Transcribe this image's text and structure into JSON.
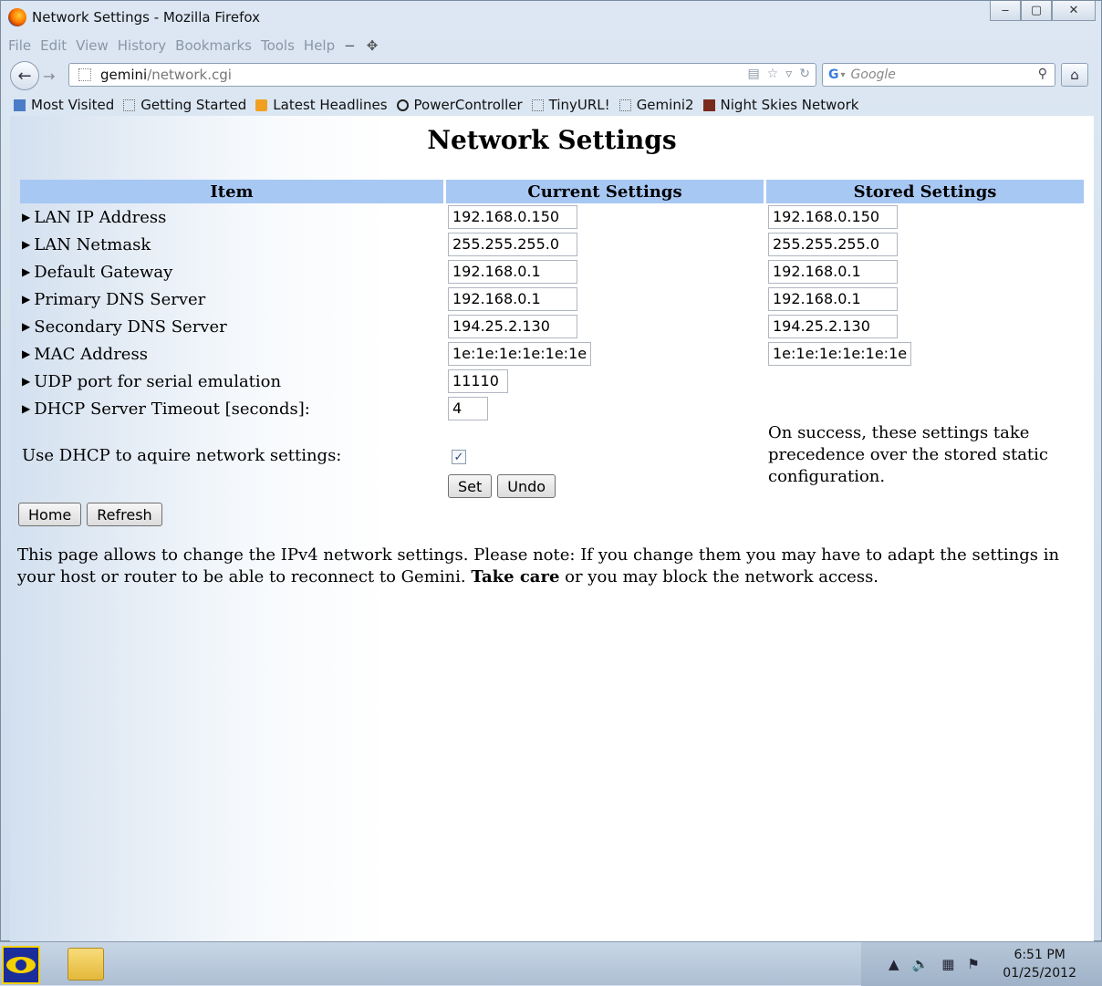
{
  "window": {
    "title": "Network Settings - Mozilla Firefox",
    "controls": {
      "minimize": "▭",
      "maximize": "▢",
      "close": "✕"
    }
  },
  "menu": [
    "File",
    "Edit",
    "View",
    "History",
    "Bookmarks",
    "Tools",
    "Help"
  ],
  "nav": {
    "url_host": "gemini",
    "url_path": "/network.cgi",
    "search_placeholder": "Google"
  },
  "bookmarks": [
    {
      "label": "Most Visited",
      "icon": "most-visited-icon"
    },
    {
      "label": "Getting Started",
      "icon": "page-icon"
    },
    {
      "label": "Latest Headlines",
      "icon": "rss-icon"
    },
    {
      "label": "PowerController",
      "icon": "power-icon"
    },
    {
      "label": "TinyURL!",
      "icon": "page-icon"
    },
    {
      "label": "Gemini2",
      "icon": "page-icon"
    },
    {
      "label": "Night Skies Network",
      "icon": "night-skies-icon"
    }
  ],
  "page": {
    "title": "Network Settings",
    "headers": {
      "item": "Item",
      "current": "Current Settings",
      "stored": "Stored Settings"
    },
    "rows": [
      {
        "label": "LAN IP Address",
        "current": "192.168.0.150",
        "stored": "192.168.0.150"
      },
      {
        "label": "LAN Netmask",
        "current": "255.255.255.0",
        "stored": "255.255.255.0"
      },
      {
        "label": "Default Gateway",
        "current": "192.168.0.1",
        "stored": "192.168.0.1"
      },
      {
        "label": "Primary DNS Server",
        "current": "192.168.0.1",
        "stored": "192.168.0.1"
      },
      {
        "label": "Secondary DNS Server",
        "current": "194.25.2.130",
        "stored": "194.25.2.130"
      },
      {
        "label": "MAC Address",
        "current": "1e:1e:1e:1e:1e:1e",
        "stored": "1e:1e:1e:1e:1e:1e"
      },
      {
        "label": "UDP port for serial emulation",
        "current": "11110"
      },
      {
        "label": "DHCP Server Timeout [seconds]:",
        "current": "4"
      }
    ],
    "dhcp": {
      "label": "Use DHCP to aquire network settings:",
      "checked": true,
      "note": "On success, these settings take precedence over the stored static configuration."
    },
    "buttons": {
      "set": "Set",
      "undo": "Undo",
      "home": "Home",
      "refresh": "Refresh"
    },
    "description_part1": "This page allows to change the IPv4 network settings. Please note: If you change them you may have to adapt the settings in your host or router to be able to reconnect to Gemini. ",
    "description_bold": "Take care",
    "description_part2": " or you may block the network access."
  },
  "taskbar": {
    "time": "6:51 PM",
    "date": "01/25/2012"
  }
}
